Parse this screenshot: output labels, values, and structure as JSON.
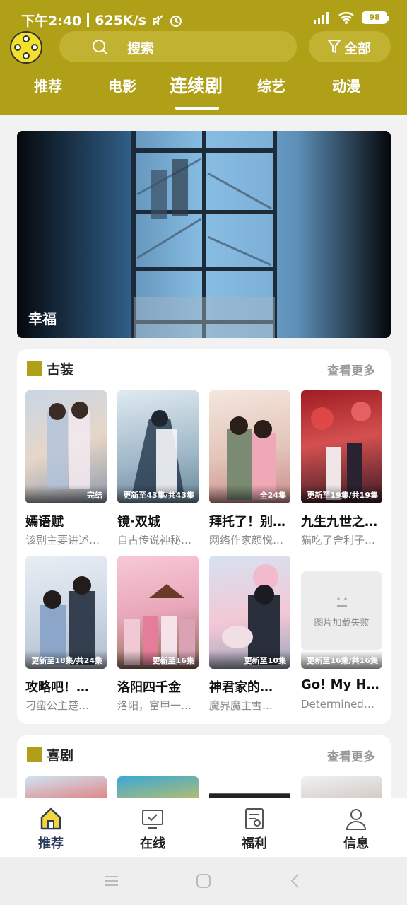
{
  "status_bar": {
    "time_speed": "下午2:40",
    "net_speed": "625K/s",
    "battery": "98"
  },
  "header": {
    "search_placeholder": "搜索",
    "filter_label": "全部",
    "tabs": [
      {
        "label": "推荐"
      },
      {
        "label": "电影"
      },
      {
        "label": "连续剧"
      },
      {
        "label": "综艺"
      },
      {
        "label": "动漫"
      }
    ],
    "active_tab": "连续剧"
  },
  "banner": {
    "title": "幸福"
  },
  "sections": [
    {
      "title": "古装",
      "more": "查看更多",
      "items": [
        {
          "title": "嫣语赋",
          "desc": "该剧主要讲述了…",
          "badge": "完结"
        },
        {
          "title": "镜·双城",
          "desc": "自古传说神秘的…",
          "badge": "更新至43集/共43集"
        },
        {
          "title": "拜托了！别宠我",
          "desc": "网络作家颜悦…",
          "badge": "全24集"
        },
        {
          "title": "九生九世之…",
          "desc": "猫吃了舍利子…",
          "badge": "更新至19集/共19集"
        },
        {
          "title": "攻略吧！…",
          "desc": "刁蛮公主楚…",
          "badge": "更新至18集/共24集"
        },
        {
          "title": "洛阳四千金",
          "desc": "洛阳，富甲一方…",
          "badge": "更新至16集"
        },
        {
          "title": "神君家的…",
          "desc": "魔界魔主雪…",
          "badge": "更新至10集"
        },
        {
          "title": "Go! My H…",
          "desc": "Determined…",
          "badge": "更新至16集/共16集",
          "failed": true,
          "fail_text": "图片加载失败"
        }
      ]
    },
    {
      "title": "喜剧",
      "more": "查看更多"
    }
  ],
  "bottom_nav": [
    {
      "label": "推荐",
      "icon": "home-icon"
    },
    {
      "label": "在线",
      "icon": "tv-icon"
    },
    {
      "label": "福利",
      "icon": "document-icon"
    },
    {
      "label": "信息",
      "icon": "user-icon"
    }
  ],
  "colors": {
    "primary": "#b0a018",
    "nav_active": "#2b3c5a"
  }
}
